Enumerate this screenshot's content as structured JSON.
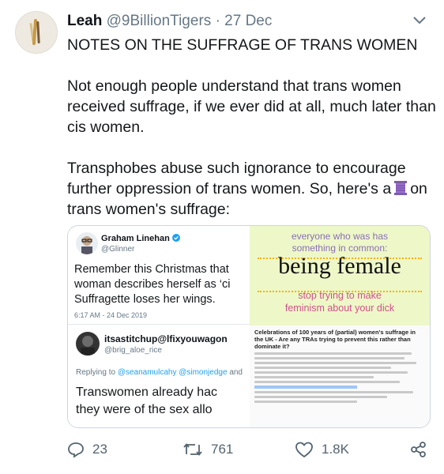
{
  "tweet": {
    "name": "Leah",
    "handle": "@9BillionTigers",
    "separator": "·",
    "date": "27 Dec",
    "paragraphs": [
      "NOTES ON THE SUFFRAGE OF TRANS WOMEN",
      "Not enough people understand that trans women received suffrage, if we ever did at all, much later than cis women.",
      "Transphobes abuse such ignorance to encourage further oppression of trans women. So, here's a",
      "on trans women's suffrage:"
    ]
  },
  "embed": {
    "graham": {
      "name": "Graham Linehan",
      "handle": "@Glinner",
      "text": [
        "Remember this Christmas that",
        "woman describes herself as ‘ci",
        "Suffragette loses her wings."
      ],
      "time": "6:17 AM - 24 Dec 2019"
    },
    "itsastitchup": {
      "name": "itsastitchup@lfixyouwagon",
      "handle": "@brig_aloe_rice",
      "reply_prefix": "Replying to",
      "mentions": "@seanamulcahy @simonjedge",
      "reply_suffix": "and",
      "text": [
        "Transwomen already hac",
        "they were of the sex allo"
      ]
    },
    "sticker": {
      "line1": "everyone who was has",
      "line2": "something in common:",
      "big": "being female",
      "line3": "stop trying to make",
      "line4": "feminism about your dick"
    },
    "forum": {
      "title": "Celebrations of 100 years of (partial) women's suffrage in the UK - Are any TRAs trying to prevent this rather than dominate it?"
    }
  },
  "actions": {
    "replies": "23",
    "retweets": "761",
    "likes": "1.8K"
  },
  "colors": {
    "secondary_text": "#657786",
    "link": "#1da1f2",
    "sticker_bg": "#eef7c8",
    "sticker_purple": "#8a6fb5",
    "sticker_pink": "#d0528c"
  },
  "icons": [
    "chevron-down-icon",
    "thread-spool-icon",
    "verified-badge-icon",
    "reply-icon",
    "retweet-icon",
    "like-icon",
    "share-icon"
  ]
}
